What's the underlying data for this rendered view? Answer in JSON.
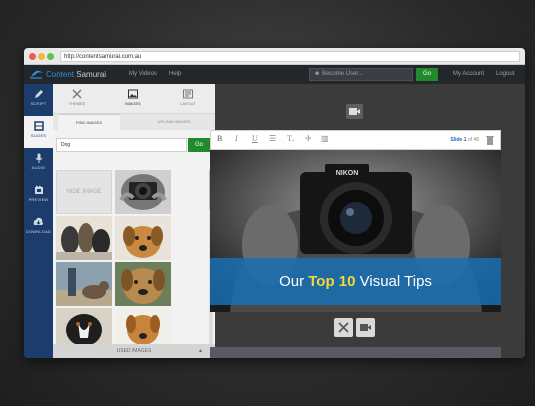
{
  "browser": {
    "url": "http://contentsamurai.com.au",
    "dots": [
      "#f05a4f",
      "#f3b73c",
      "#5fc24d"
    ]
  },
  "app_nav": {
    "logo_prefix": "Content",
    "logo_suffix": "Samurai",
    "links": [
      "My Videos",
      "Help"
    ],
    "become_user_label": "Become User...",
    "go_label": "Go",
    "account_label": "My Account",
    "logout_label": "Logout"
  },
  "left_sidebar": {
    "items": [
      {
        "label": "SCRIPT",
        "icon": "pencil-icon"
      },
      {
        "label": "SLIDES",
        "icon": "slides-icon",
        "active": true
      },
      {
        "label": "AUDIO",
        "icon": "microphone-icon"
      },
      {
        "label": "PREVIEW",
        "icon": "film-icon"
      },
      {
        "label": "DOWNLOAD",
        "icon": "cloud-download-icon"
      }
    ]
  },
  "panel": {
    "tool_tabs": [
      {
        "label": "THEMES",
        "icon": "scissors-icon"
      },
      {
        "label": "IMAGES",
        "icon": "image-icon",
        "active": true
      },
      {
        "label": "LAYOUT",
        "icon": "layout-icon"
      }
    ],
    "sub_tabs": [
      {
        "label": "FIND IMAGES",
        "active": true
      },
      {
        "label": "UPLOAD IMAGES"
      }
    ],
    "search_value": "Dog",
    "search_go_label": "Go",
    "hide_image_label": "HIDE IMAGE",
    "used_images_label": "USED IMAGES"
  },
  "editor": {
    "toolbar_buttons": [
      "B",
      "I",
      "U",
      "☰",
      "Tₓ",
      "✛",
      "▥"
    ],
    "slide_label": "Slide 1",
    "slide_of": "of 48",
    "headline_before": "Our ",
    "headline_highlight": "Top 10",
    "headline_after": " Visual Tips"
  },
  "colors": {
    "accent_green": "#1f8a2e",
    "sidebar_blue": "#1c3c6b",
    "brand_blue": "#2f8fd8",
    "highlight_yellow": "#f2d83a"
  }
}
